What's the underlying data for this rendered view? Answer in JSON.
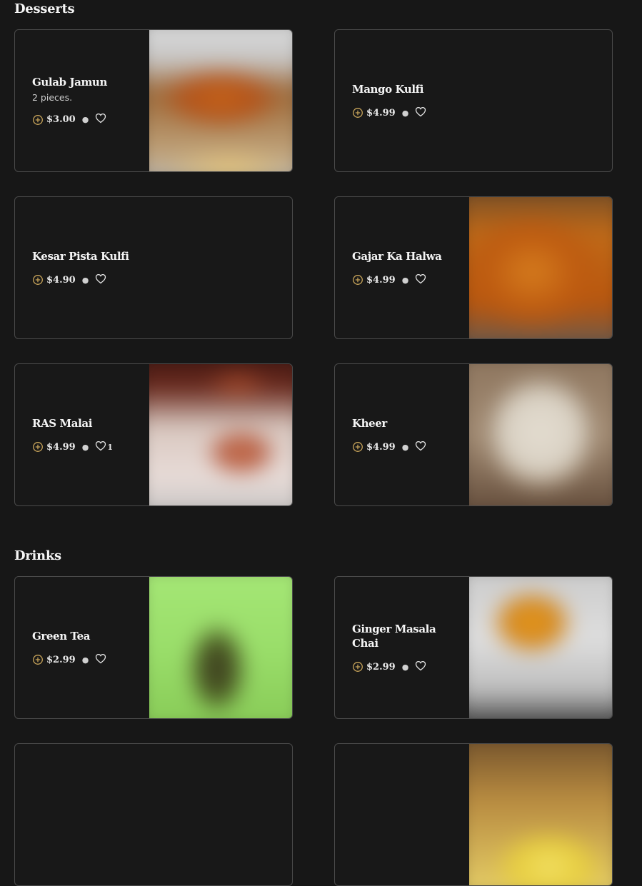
{
  "sections": [
    {
      "title": "Desserts"
    },
    {
      "title": "Drinks"
    }
  ],
  "items": [
    {
      "name": "Gulab Jamun",
      "description": "2 pieces.",
      "price": "$3.00",
      "likes": "",
      "image": "gulab-jamun-photo"
    },
    {
      "name": "Mango Kulfi",
      "description": "",
      "price": "$4.99",
      "likes": "",
      "image": ""
    },
    {
      "name": "Kesar Pista Kulfi",
      "description": "",
      "price": "$4.90",
      "likes": "",
      "image": ""
    },
    {
      "name": "Gajar Ka Halwa",
      "description": "",
      "price": "$4.99",
      "likes": "",
      "image": "gajar-ka-halwa-photo"
    },
    {
      "name": "RAS Malai",
      "description": "",
      "price": "$4.99",
      "likes": "1",
      "image": "ras-malai-photo"
    },
    {
      "name": "Kheer",
      "description": "",
      "price": "$4.99",
      "likes": "",
      "image": "kheer-photo"
    },
    {
      "name": "Green Tea",
      "description": "",
      "price": "$2.99",
      "likes": "",
      "image": "green-tea-photo"
    },
    {
      "name": "Ginger Masala Chai",
      "description": "",
      "price": "$2.99",
      "likes": "",
      "image": "ginger-masala-chai-photo"
    },
    {
      "name": "",
      "description": "",
      "price": "",
      "likes": "",
      "image": ""
    },
    {
      "name": "",
      "description": "",
      "price": "",
      "likes": "",
      "image": "drink-photo"
    }
  ],
  "icons": {
    "add": "plus-circle-icon",
    "favorite": "heart-outline-icon"
  },
  "colors": {
    "background": "#171717",
    "card_border": "#4a4a4a",
    "accent": "#c8a45a",
    "text": "#f5f5f5"
  }
}
